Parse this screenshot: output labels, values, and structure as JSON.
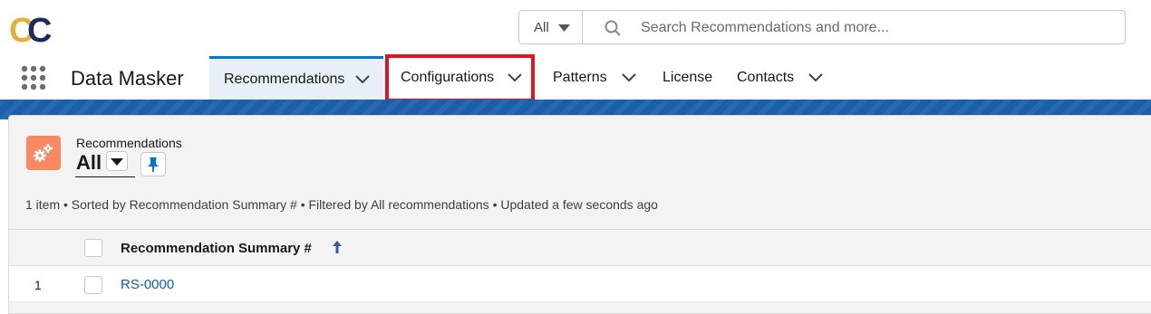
{
  "brand": {
    "logo_text": "CC",
    "logo_colors": [
      "#e5b13a",
      "#1d2c5e"
    ]
  },
  "search": {
    "scope_label": "All",
    "placeholder": "Search Recommendations and more..."
  },
  "nav": {
    "app_name": "Data Masker",
    "tabs": [
      {
        "label": "Recommendations",
        "has_menu": true,
        "active": true
      },
      {
        "label": "Configurations",
        "has_menu": true,
        "active": false,
        "highlighted": true
      },
      {
        "label": "Patterns",
        "has_menu": true,
        "active": false
      },
      {
        "label": "License",
        "has_menu": false,
        "active": false
      },
      {
        "label": "Contacts",
        "has_menu": true,
        "active": false
      }
    ]
  },
  "list": {
    "object_label": "Recommendations",
    "view_name": "All",
    "info": "1 item • Sorted by Recommendation Summary # • Filtered by All recommendations • Updated a few seconds ago",
    "columns": [
      {
        "label": "Recommendation Summary #",
        "sort": "ascending"
      }
    ],
    "rows": [
      {
        "number": "1",
        "summary": "RS-0000"
      }
    ]
  },
  "colors": {
    "accent": "#0176d3",
    "band": "#1b5faa",
    "highlight": "#e1141f",
    "object_icon": "#f88962",
    "link": "#0b5cab"
  }
}
